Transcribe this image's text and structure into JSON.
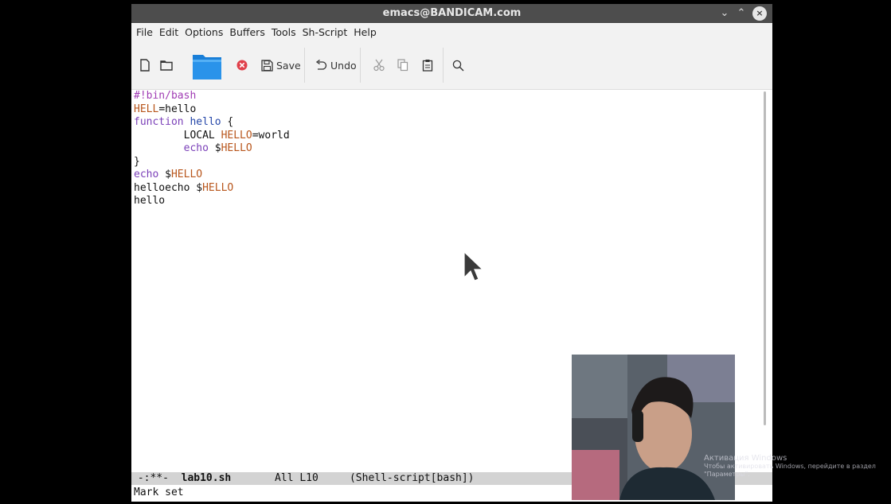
{
  "window": {
    "title": "emacs@BANDICAM.com",
    "minimize_glyph": "⌄",
    "maximize_glyph": "⌃",
    "close_glyph": "×"
  },
  "menubar": {
    "items": [
      "File",
      "Edit",
      "Options",
      "Buffers",
      "Tools",
      "Sh-Script",
      "Help"
    ]
  },
  "toolbar": {
    "new_file_icon": "new-file-icon",
    "open_dir_icon": "open-folder-icon",
    "folder_icon": "folder-icon",
    "close_icon": "close-icon",
    "save_label": "Save",
    "undo_label": "Undo",
    "cut_icon": "scissors-icon",
    "copy_icon": "copy-icon",
    "paste_icon": "paste-icon",
    "search_icon": "search-icon"
  },
  "editor": {
    "lines": [
      [
        {
          "t": "#!bin/bash",
          "c": "kw-comment"
        }
      ],
      [
        {
          "t": "HELL",
          "c": "kw-var"
        },
        {
          "t": "=hello",
          "c": ""
        }
      ],
      [
        {
          "t": "function ",
          "c": "kw-builtin"
        },
        {
          "t": "hello",
          "c": "kw-func"
        },
        {
          "t": " {",
          "c": ""
        }
      ],
      [
        {
          "t": "        LOCAL ",
          "c": ""
        },
        {
          "t": "HELLO",
          "c": "kw-var"
        },
        {
          "t": "=world",
          "c": ""
        }
      ],
      [
        {
          "t": "        ",
          "c": ""
        },
        {
          "t": "echo",
          "c": "kw-builtin"
        },
        {
          "t": " $",
          "c": ""
        },
        {
          "t": "HELLO",
          "c": "kw-var"
        }
      ],
      [
        {
          "t": "}",
          "c": ""
        }
      ],
      [
        {
          "t": "echo",
          "c": "kw-builtin"
        },
        {
          "t": " $",
          "c": ""
        },
        {
          "t": "HELLO",
          "c": "kw-var"
        }
      ],
      [
        {
          "t": "helloecho $",
          "c": ""
        },
        {
          "t": "HELLO",
          "c": "kw-var"
        }
      ],
      [
        {
          "t": "hello",
          "c": ""
        }
      ]
    ]
  },
  "modeline": {
    "status": " -:**-  ",
    "buffer": "lab10.sh",
    "position": "       All L10     ",
    "mode": "(Shell-script[bash])"
  },
  "echo_area": {
    "text": "Mark set"
  },
  "overlay": {
    "watermark_line1": "Активация Windows",
    "watermark_line2": "Чтобы активировать Windows, перейдите в раздел \"Параметры\"."
  },
  "colors": {
    "titlebar": "#4d4d4d",
    "menubar": "#f2f2f2",
    "modeline": "#d3d3d3",
    "comment": "#a03cb4",
    "variable": "#b8561c",
    "builtin": "#7a3fb8",
    "function_name": "#2345a8"
  }
}
